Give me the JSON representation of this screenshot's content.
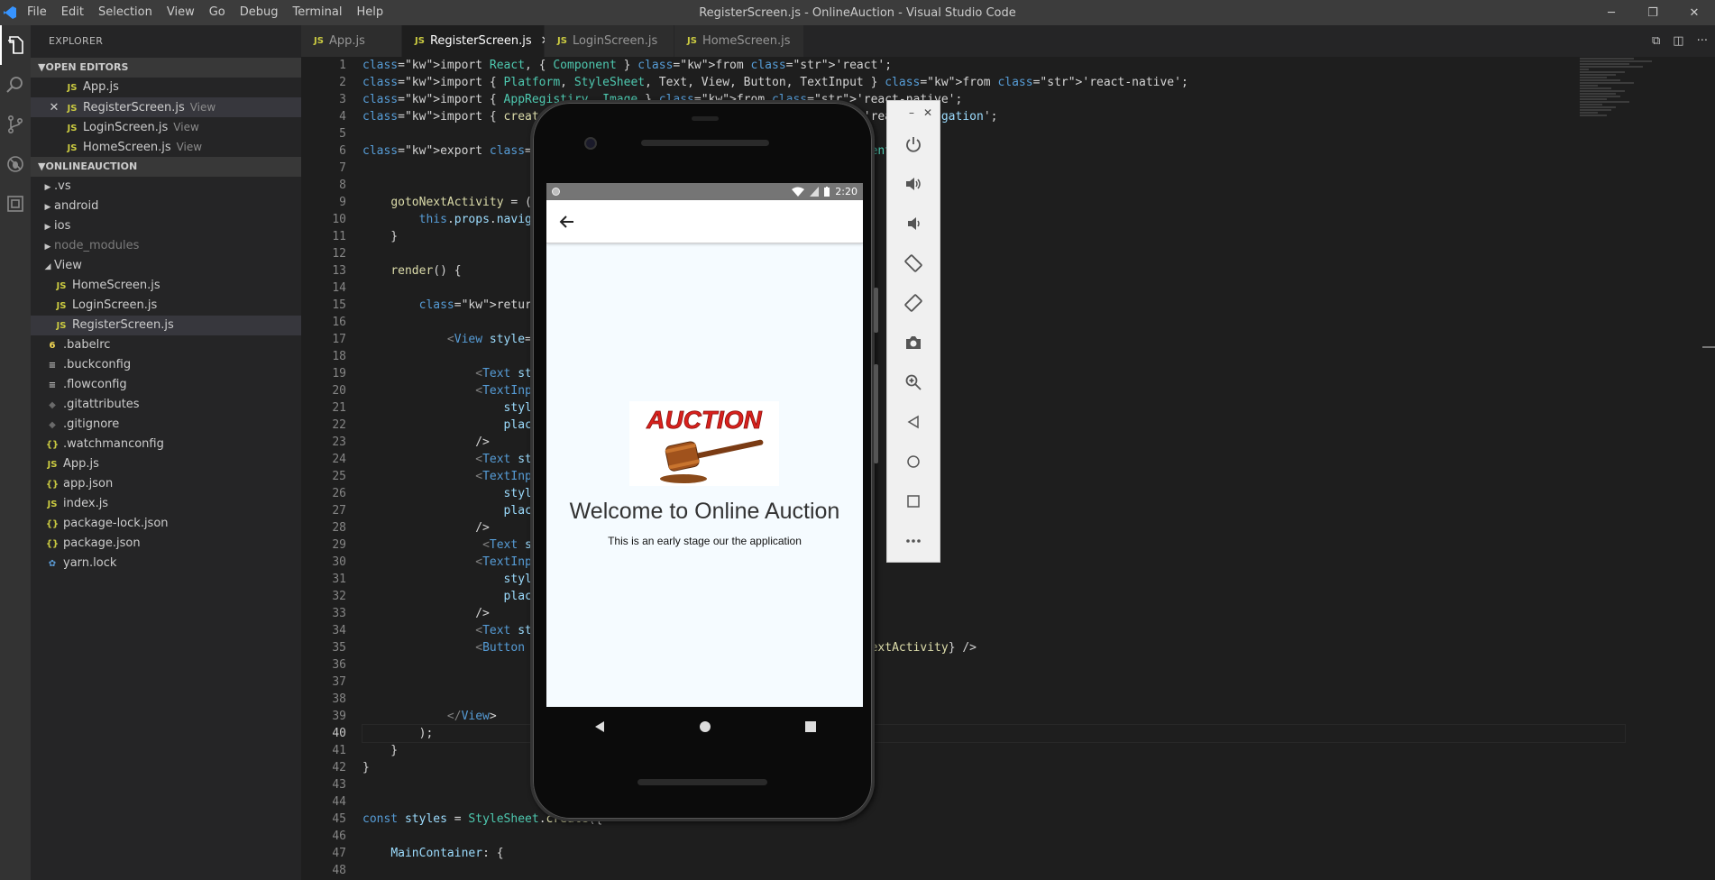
{
  "window": {
    "title": "RegisterScreen.js - OnlineAuction - Visual Studio Code",
    "menu": [
      "File",
      "Edit",
      "Selection",
      "View",
      "Go",
      "Debug",
      "Terminal",
      "Help"
    ],
    "controls": [
      "─",
      "❐",
      "✕"
    ]
  },
  "sidebar": {
    "title": "EXPLORER",
    "open_editors_header": "OPEN EDITORS",
    "open_editors": [
      {
        "name": "App.js",
        "sub": ""
      },
      {
        "name": "RegisterScreen.js",
        "sub": "View"
      },
      {
        "name": "LoginScreen.js",
        "sub": "View"
      },
      {
        "name": "HomeScreen.js",
        "sub": "View"
      }
    ],
    "project_header": "ONLINEAUCTION",
    "tree": [
      ".vs",
      "android",
      "ios",
      "node_modules",
      "View",
      "HomeScreen.js",
      "LoginScreen.js",
      "RegisterScreen.js",
      ".babelrc",
      ".buckconfig",
      ".flowconfig",
      ".gitattributes",
      ".gitignore",
      ".watchmanconfig",
      "App.js",
      "app.json",
      "index.js",
      "package-lock.json",
      "package.json",
      "yarn.lock"
    ],
    "icon_js": "JS",
    "icon_json": "{}"
  },
  "tabs": [
    {
      "label": "App.js"
    },
    {
      "label": "RegisterScreen.js",
      "close": "✕"
    },
    {
      "label": "LoginScreen.js"
    },
    {
      "label": "HomeScreen.js"
    }
  ],
  "editor": {
    "line_numbers": [
      "1",
      "2",
      "3",
      "4",
      "5",
      "6",
      "7",
      "8",
      "9",
      "10",
      "11",
      "12",
      "13",
      "14",
      "15",
      "16",
      "17",
      "18",
      "19",
      "20",
      "21",
      "22",
      "23",
      "24",
      "25",
      "26",
      "27",
      "28",
      "29",
      "30",
      "31",
      "32",
      "33",
      "34",
      "35",
      "36",
      "37",
      "38",
      "39",
      "40",
      "41",
      "42",
      "43",
      "44",
      "45",
      "46",
      "47",
      "48"
    ],
    "lines": [
      "import React, { Component } from 'react';",
      "import { Platform, StyleSheet, Text, View, Button, TextInput } from 'react-native';",
      "import { AppRegistiry, Image } from 'react-native';",
      "import { createStackNavigator } from 'react-navigation';",
      "",
      "export default class RegisterScreen extends Component {",
      "",
      "",
      "    gotoNextActivity = () => {",
      "        this.props.navigation.navigate('Second');",
      "    }",
      "",
      "    render() {",
      "",
      "        return (",
      "",
      "            <View style={styles.MainContainer}>",
      "",
      "                <Text style={styles.text}>Name</Text>",
      "                <TextInput",
      "                    style={styles.input}",
      "                    placeholder='Name'",
      "                />",
      "                <Text style={styles.text}>Email</Text>",
      "                <TextInput",
      "                    style={styles.input}",
      "                    placeholder='Email'",
      "                />",
      "                 <Text style={styles.text}>Password</Text>",
      "                <TextInput",
      "                    style={styles.input}",
      "                    placeholder='Password'",
      "                />",
      "                <Text style={styles.text}>Confirm</Text>",
      "                <Button title='Register' onPress={this.gotoNextActivity} />",
      "",
      "",
      "",
      "            </View>",
      "        );",
      "    }",
      "}",
      "",
      "",
      "const styles = StyleSheet.create({",
      "",
      "    MainContainer: {",
      ""
    ]
  },
  "emulator": {
    "time": "2:20",
    "welcome": "Welcome to Online Auction",
    "tagline": "This is an early stage our the application",
    "logo_text": "AUCTION",
    "panel_buttons": [
      "power-icon",
      "volume-up-icon",
      "volume-down-icon",
      "rotate-left-icon",
      "rotate-right-icon",
      "camera-icon",
      "zoom-icon",
      "back-icon",
      "home-icon",
      "overview-icon",
      "more-icon"
    ],
    "panel_top": [
      "–",
      "✕"
    ]
  },
  "colors": {
    "titlebar": "#3c3c3c",
    "activitybar": "#333333",
    "sidebar": "#252526",
    "editor": "#1e1e1e",
    "accent": "#3794ff"
  }
}
